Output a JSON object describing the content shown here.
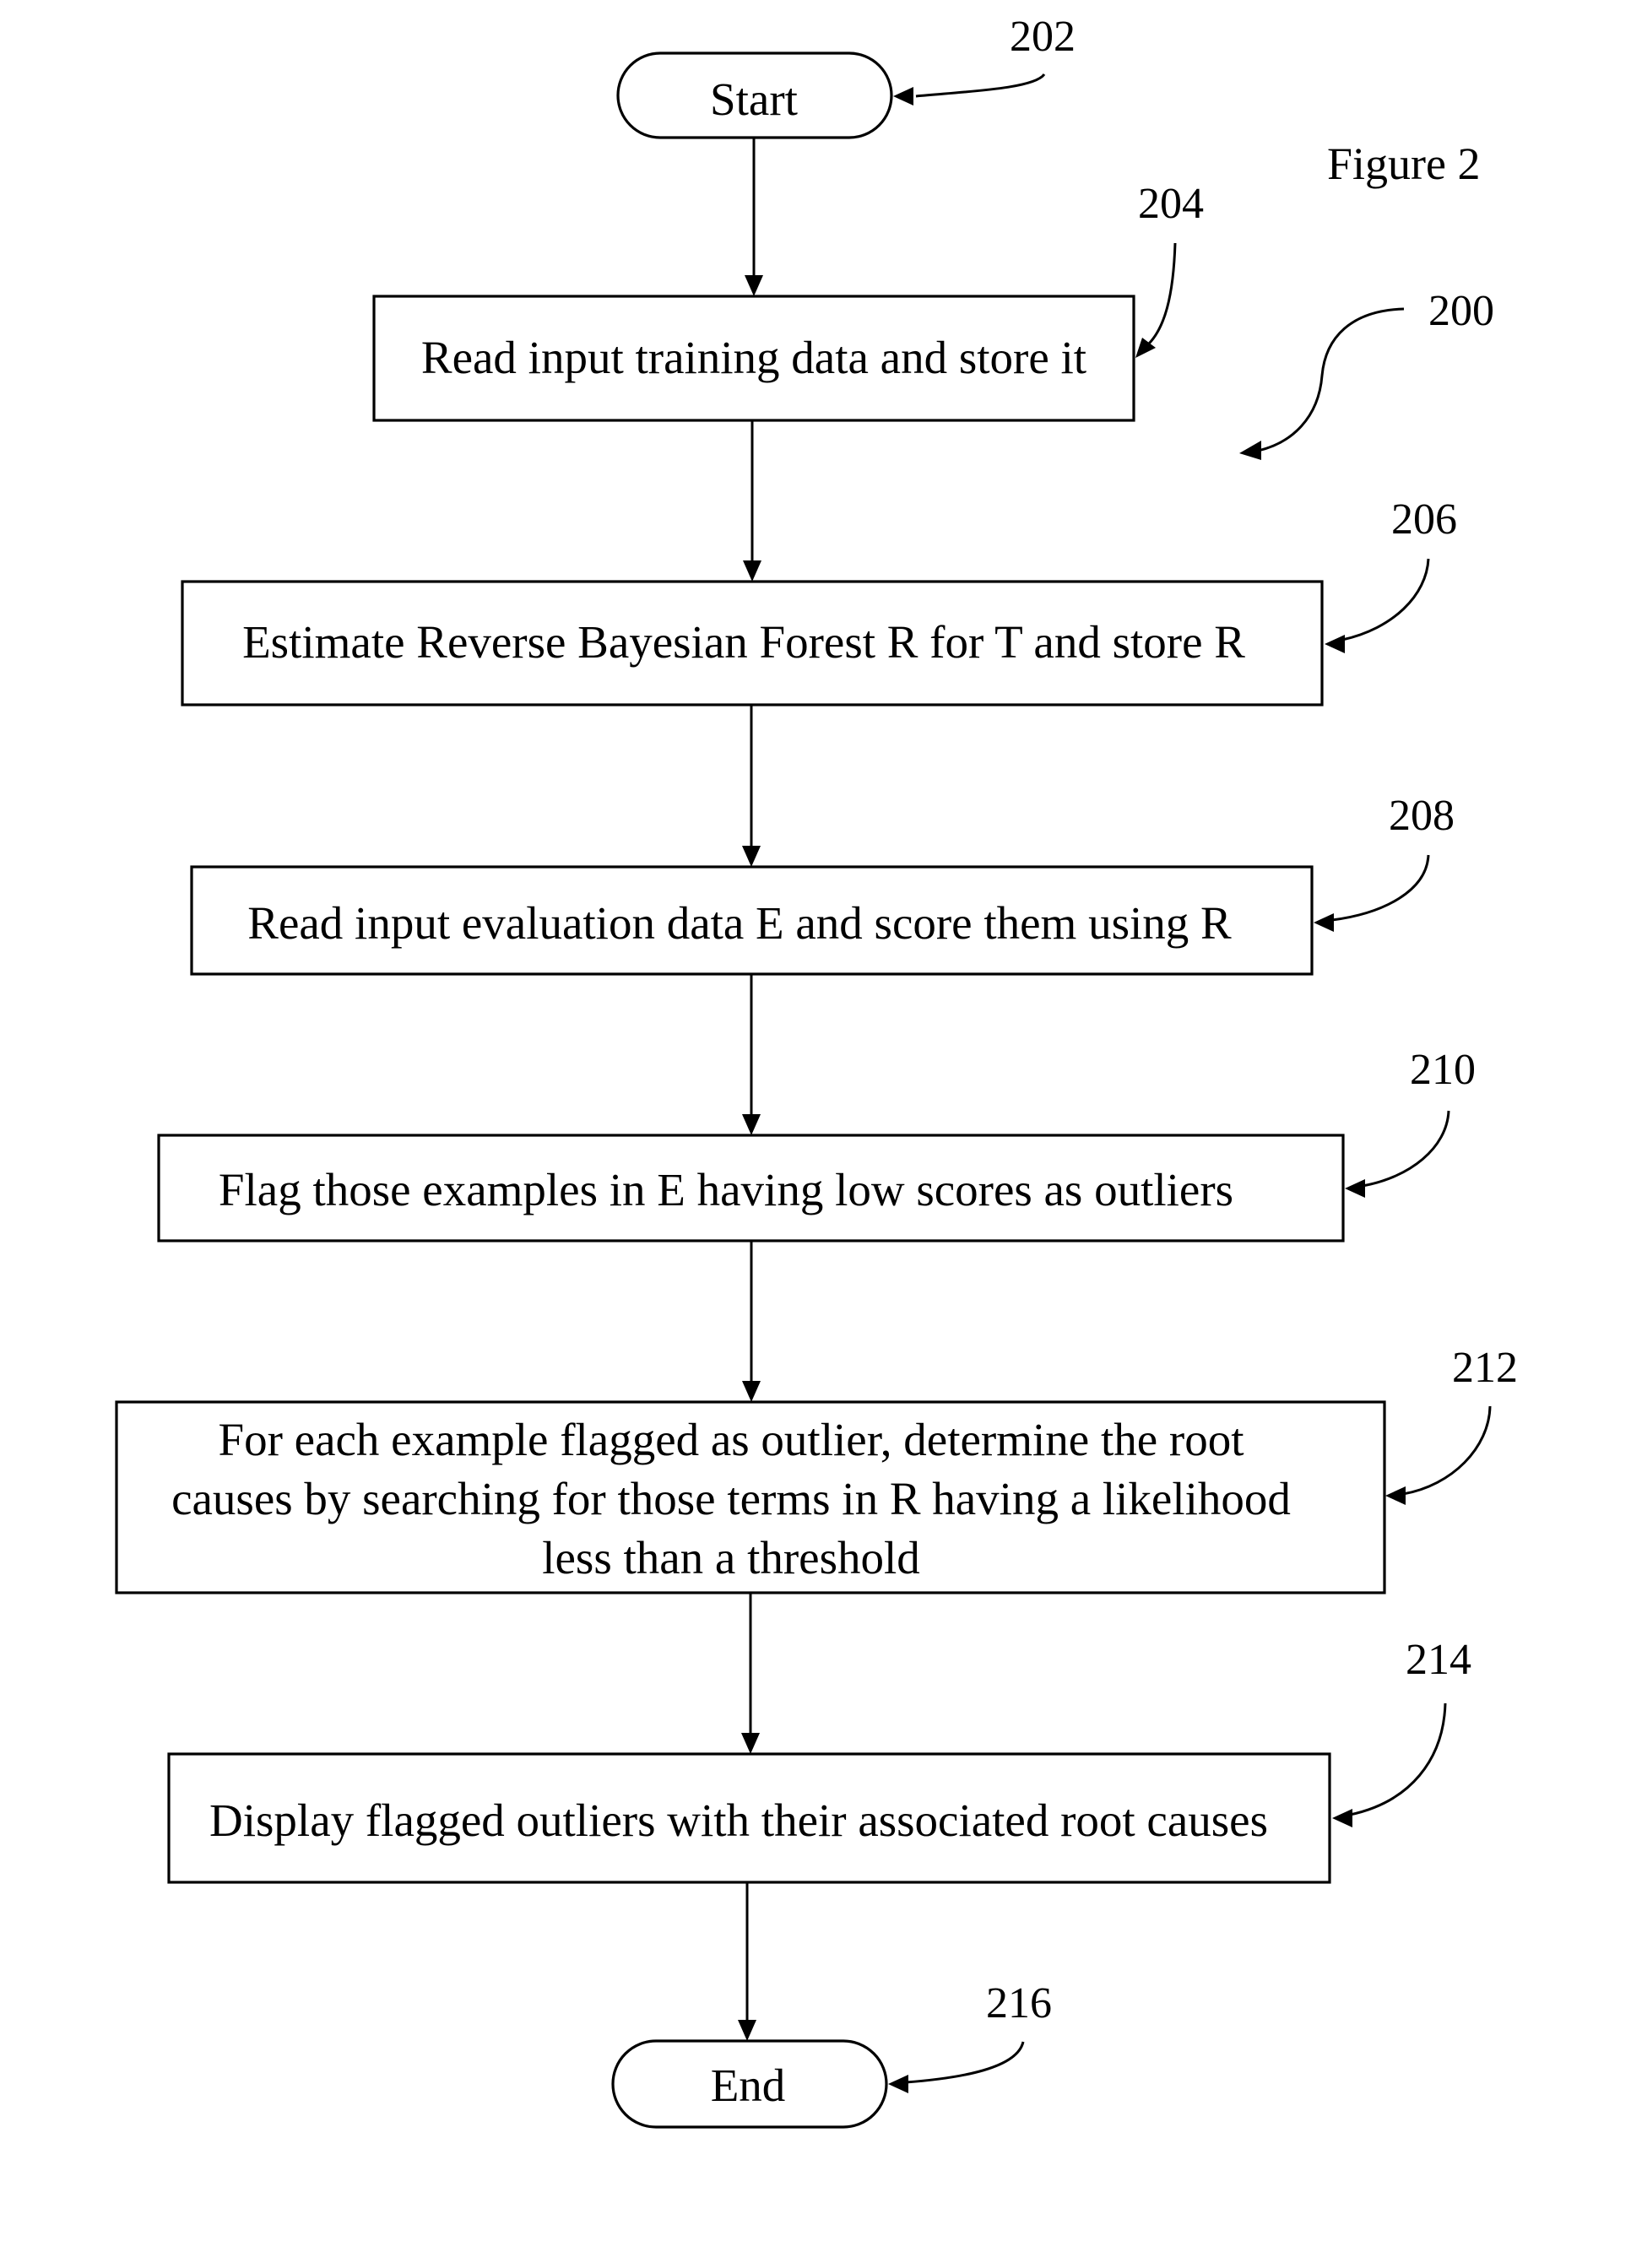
{
  "figure": {
    "title": "Figure 2",
    "reference": "200"
  },
  "flowchart": {
    "nodes": [
      {
        "id": "202",
        "type": "terminal",
        "text": [
          "Start"
        ]
      },
      {
        "id": "204",
        "type": "process",
        "text": [
          "Read input training data and store it"
        ]
      },
      {
        "id": "206",
        "type": "process",
        "text": [
          "Estimate Reverse Bayesian Forest R for T and store R"
        ]
      },
      {
        "id": "208",
        "type": "process",
        "text": [
          "Read input evaluation data E and score them using R"
        ]
      },
      {
        "id": "210",
        "type": "process",
        "text": [
          "Flag those examples in E having low scores as outliers"
        ]
      },
      {
        "id": "212",
        "type": "process",
        "text": [
          "For each example flagged as outlier, determine the root",
          "causes by searching for those terms in R having a likelihood",
          "less than a threshold"
        ]
      },
      {
        "id": "214",
        "type": "process",
        "text": [
          "Display flagged outliers with their associated root causes"
        ]
      },
      {
        "id": "216",
        "type": "terminal",
        "text": [
          "End"
        ]
      }
    ],
    "edges": [
      [
        "202",
        "204"
      ],
      [
        "204",
        "206"
      ],
      [
        "206",
        "208"
      ],
      [
        "208",
        "210"
      ],
      [
        "210",
        "212"
      ],
      [
        "212",
        "214"
      ],
      [
        "214",
        "216"
      ]
    ]
  },
  "colors": {
    "ink": "#000000",
    "paper": "#ffffff"
  }
}
